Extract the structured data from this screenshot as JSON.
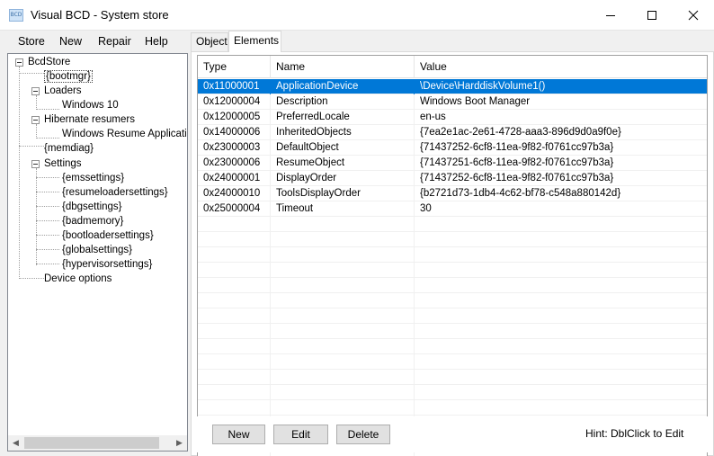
{
  "window": {
    "title": "Visual BCD - System store",
    "icon_text": "BCD"
  },
  "menu": [
    {
      "label": "Store"
    },
    {
      "label": "New"
    },
    {
      "label": "Repair"
    },
    {
      "label": "Help"
    }
  ],
  "tree": {
    "root": "BcdStore",
    "nodes": [
      {
        "label": "{bootmgr}"
      },
      {
        "label": "Loaders"
      },
      {
        "label": "Windows 10"
      },
      {
        "label": "Hibernate resumers"
      },
      {
        "label": "Windows Resume Application"
      },
      {
        "label": "{memdiag}"
      },
      {
        "label": "Settings"
      },
      {
        "label": "{emssettings}"
      },
      {
        "label": "{resumeloadersettings}"
      },
      {
        "label": "{dbgsettings}"
      },
      {
        "label": "{badmemory}"
      },
      {
        "label": "{bootloadersettings}"
      },
      {
        "label": "{globalsettings}"
      },
      {
        "label": "{hypervisorsettings}"
      },
      {
        "label": "Device options"
      }
    ]
  },
  "tabs": [
    {
      "label": "Object"
    },
    {
      "label": "Elements"
    }
  ],
  "grid": {
    "columns": [
      "Type",
      "Name",
      "Value"
    ],
    "rows": [
      {
        "type": "0x11000001",
        "name": "ApplicationDevice",
        "value": "\\Device\\HarddiskVolume1()"
      },
      {
        "type": "0x12000004",
        "name": "Description",
        "value": "Windows Boot Manager"
      },
      {
        "type": "0x12000005",
        "name": "PreferredLocale",
        "value": "en-us"
      },
      {
        "type": "0x14000006",
        "name": "InheritedObjects",
        "value": "{7ea2e1ac-2e61-4728-aaa3-896d9d0a9f0e}"
      },
      {
        "type": "0x23000003",
        "name": "DefaultObject",
        "value": "{71437252-6cf8-11ea-9f82-f0761cc97b3a}"
      },
      {
        "type": "0x23000006",
        "name": "ResumeObject",
        "value": "{71437251-6cf8-11ea-9f82-f0761cc97b3a}"
      },
      {
        "type": "0x24000001",
        "name": "DisplayOrder",
        "value": "{71437252-6cf8-11ea-9f82-f0761cc97b3a}"
      },
      {
        "type": "0x24000010",
        "name": "ToolsDisplayOrder",
        "value": "{b2721d73-1db4-4c62-bf78-c548a880142d}"
      },
      {
        "type": "0x25000004",
        "name": "Timeout",
        "value": "30"
      }
    ]
  },
  "buttons": {
    "new": "New",
    "edit": "Edit",
    "delete": "Delete"
  },
  "hint": "Hint: DblClick to Edit",
  "colors": {
    "selection": "#0078d7"
  }
}
